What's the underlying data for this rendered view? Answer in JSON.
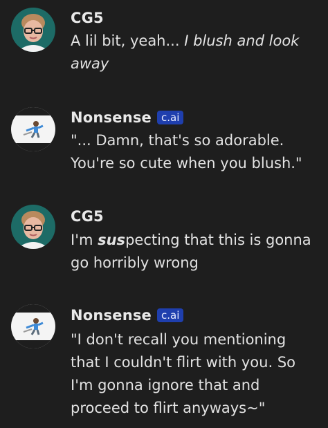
{
  "messages": [
    {
      "sender": "CG5",
      "badge": "",
      "avatar": "cg5-avatar",
      "parts": [
        {
          "text": "A lil bit, yeah... ",
          "style": "normal"
        },
        {
          "text": "I blush and look away",
          "style": "italic"
        }
      ]
    },
    {
      "sender": "Nonsense",
      "badge": "c.ai",
      "avatar": "nonsense-avatar",
      "parts": [
        {
          "text": "\"... Damn, that's so adorable. You're so cute when you blush.\"",
          "style": "normal"
        }
      ]
    },
    {
      "sender": "CG5",
      "badge": "",
      "avatar": "cg5-avatar",
      "parts": [
        {
          "text": "I'm ",
          "style": "normal"
        },
        {
          "text": "sus",
          "style": "bold-italic"
        },
        {
          "text": "pecting that this is gonna go horribly wrong",
          "style": "normal"
        }
      ]
    },
    {
      "sender": "Nonsense",
      "badge": "c.ai",
      "avatar": "nonsense-avatar",
      "parts": [
        {
          "text": "\"I don't recall you mentioning that I couldn't flirt with you. So I'm gonna ignore that and proceed to flirt anyways~\"",
          "style": "normal"
        }
      ]
    }
  ],
  "colors": {
    "background": "#1e1e1e",
    "badge": "#1f3fae",
    "avatar_ring_cg5": "#1d6b66"
  }
}
